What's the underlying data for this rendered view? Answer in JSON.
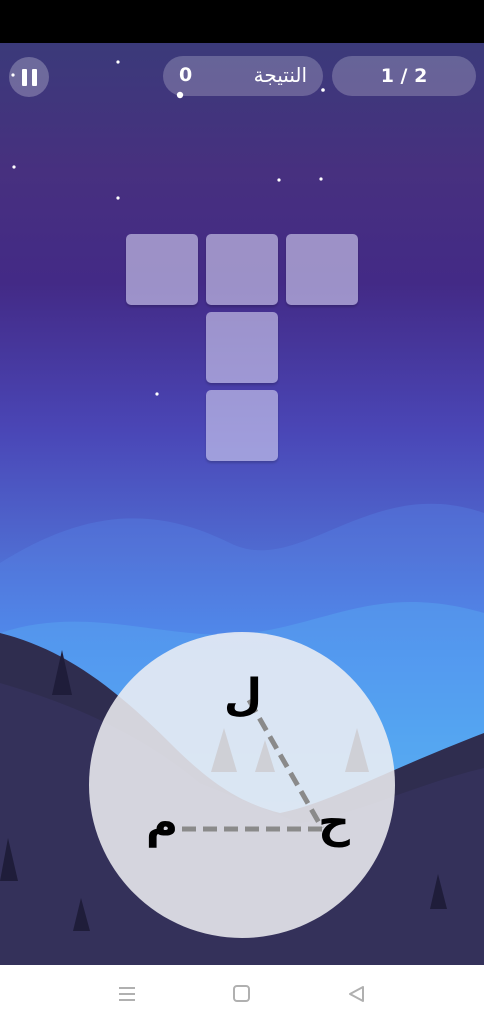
{
  "hud": {
    "score_label": "النتيجة",
    "score_value": "0",
    "level": "1 / 2"
  },
  "board": {
    "tiles": [
      "",
      "",
      "",
      "",
      ""
    ]
  },
  "wheel": {
    "letters": [
      "ل",
      "ح",
      "م"
    ],
    "connected": [
      "ل",
      "ح",
      "م"
    ]
  },
  "colors": {
    "sky_top": "#3b3a7a",
    "sky_mid": "#432a86",
    "sky_bottom": "#5fc5f8",
    "mountain": "#2f2d4f",
    "tile": "#c9c4ec",
    "wheel": "#ececef"
  },
  "icons": {
    "pause": "pause-icon",
    "nav_menu": "menu-icon",
    "nav_home": "square-icon",
    "nav_back": "back-triangle-icon"
  }
}
